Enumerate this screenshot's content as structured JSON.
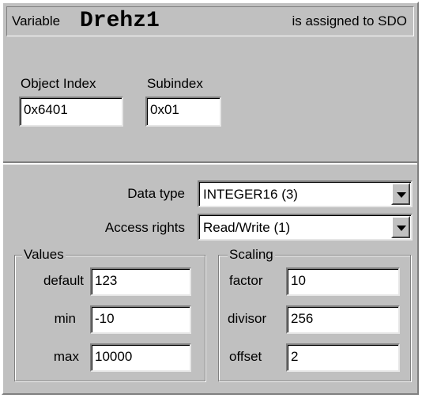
{
  "header": {
    "variable_label": "Variable",
    "variable_name": "Drehz1",
    "assigned_text": "is assigned to SDO"
  },
  "object": {
    "index_label": "Object Index",
    "index_value": "0x6401",
    "subindex_label": "Subindex",
    "subindex_value": "0x01"
  },
  "data_type": {
    "label": "Data type",
    "selected": "INTEGER16 (3)"
  },
  "access_rights": {
    "label": "Access rights",
    "selected": "Read/Write (1)"
  },
  "values": {
    "title": "Values",
    "default_label": "default",
    "default_value": "123",
    "min_label": "min",
    "min_value": "-10",
    "max_label": "max",
    "max_value": "10000"
  },
  "scaling": {
    "title": "Scaling",
    "factor_label": "factor",
    "factor_value": "10",
    "divisor_label": "divisor",
    "divisor_value": "256",
    "offset_label": "offset",
    "offset_value": "2"
  }
}
